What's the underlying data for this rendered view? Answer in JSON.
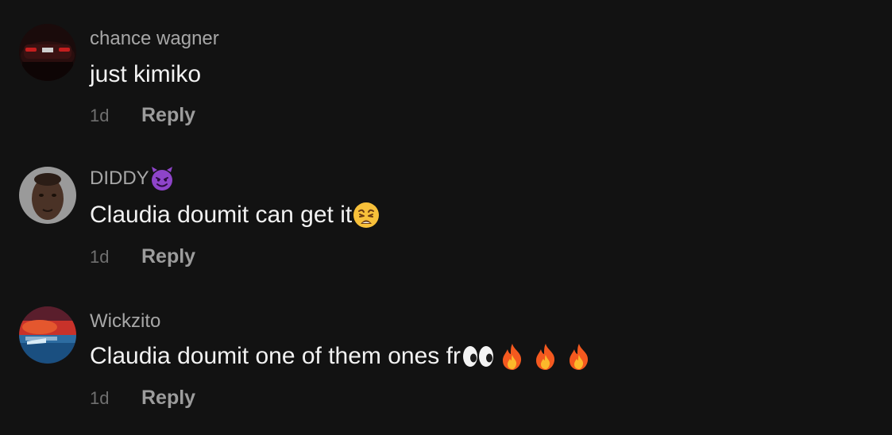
{
  "comments": [
    {
      "username": "chance wagner",
      "text": "just kimiko",
      "time": "1d",
      "reply_label": "Reply",
      "avatar_icon": "car-photo-avatar"
    },
    {
      "username": "DIDDY",
      "username_emoji": "smiling-face-with-horns",
      "text": "Claudia doumit can get it",
      "text_emoji": "weary-face",
      "time": "1d",
      "reply_label": "Reply",
      "avatar_icon": "person-photo-avatar"
    },
    {
      "username": "Wickzito",
      "text": "Claudia doumit one of them ones fr",
      "text_emoji": [
        "eyes",
        "fire",
        "fire",
        "fire"
      ],
      "time": "1d",
      "reply_label": "Reply",
      "avatar_icon": "sunset-photo-avatar"
    }
  ],
  "colors": {
    "background": "#121212",
    "username": "#a7a7a7",
    "comment_text": "#f2f2f2",
    "time": "#6f6f6f",
    "reply": "#9c9c9c"
  }
}
